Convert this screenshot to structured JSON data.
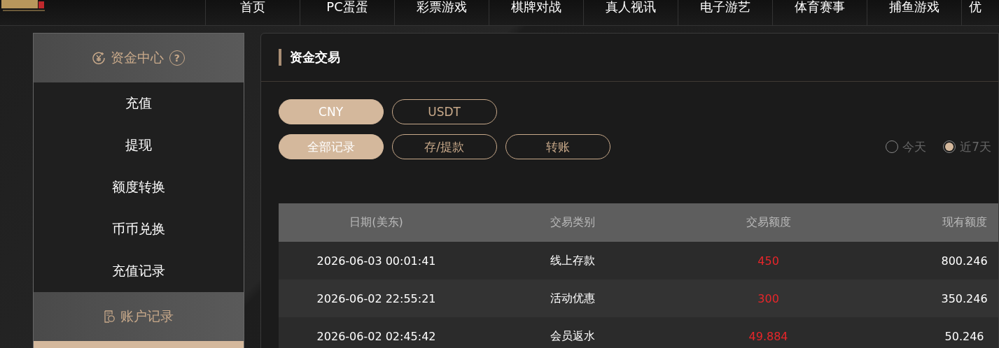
{
  "nav": {
    "items": [
      {
        "label": "首页"
      },
      {
        "label": "PC蛋蛋"
      },
      {
        "label": "彩票游戏"
      },
      {
        "label": "棋牌对战"
      },
      {
        "label": "真人视讯"
      },
      {
        "label": "电子游艺"
      },
      {
        "label": "体育赛事"
      },
      {
        "label": "捕鱼游戏"
      },
      {
        "label": "优"
      }
    ]
  },
  "sidebar": {
    "sections": [
      {
        "title": "资金中心",
        "help": "?",
        "items": [
          {
            "label": "充值"
          },
          {
            "label": "提现"
          },
          {
            "label": "额度转换"
          },
          {
            "label": "币币兑换"
          },
          {
            "label": "充值记录"
          }
        ]
      },
      {
        "title": "账户记录"
      }
    ]
  },
  "panel": {
    "title": "资金交易",
    "currency_tabs": [
      {
        "label": "CNY",
        "selected": true
      },
      {
        "label": "USDT",
        "selected": false
      }
    ],
    "type_tabs": [
      {
        "label": "全部记录",
        "selected": true
      },
      {
        "label": "存/提款",
        "selected": false
      },
      {
        "label": "转账",
        "selected": false
      }
    ],
    "range_options": [
      {
        "label": "今天",
        "selected": false
      },
      {
        "label": "近7天",
        "selected": true
      }
    ],
    "table": {
      "columns": [
        "日期(美东)",
        "交易类别",
        "交易额度",
        "现有额度"
      ],
      "rows": [
        {
          "date": "2026-06-03 00:01:41",
          "type": "线上存款",
          "amount": "450",
          "balance": "800.246"
        },
        {
          "date": "2026-06-02 22:55:21",
          "type": "活动优惠",
          "amount": "300",
          "balance": "350.246"
        },
        {
          "date": "2026-06-02 02:45:42",
          "type": "会员返水",
          "amount": "49.884",
          "balance": "50.246"
        }
      ]
    }
  }
}
